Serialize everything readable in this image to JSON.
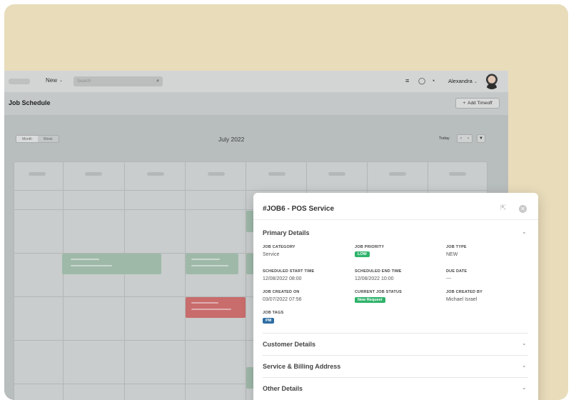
{
  "topbar": {
    "new_label": "New",
    "search_placeholder": "Search",
    "user_name": "Alexandra"
  },
  "page": {
    "title": "Job Schedule",
    "add_timeoff_label": "Add Timeoff"
  },
  "calendar": {
    "view_options": [
      "Month",
      "Week"
    ],
    "active_view": "Month",
    "month_title": "July 2022",
    "today_label": "Today"
  },
  "panel": {
    "title": "#JOB6 - POS Service",
    "sections": {
      "primary": "Primary Details",
      "customer": "Customer Details",
      "billing": "Service & Billing Address",
      "other": "Other Details"
    },
    "fields": {
      "job_category": {
        "label": "JOB CATEGORY",
        "value": "Service"
      },
      "job_priority": {
        "label": "JOB PRIORITY",
        "value": "LOW"
      },
      "job_type": {
        "label": "JOB TYPE",
        "value": "NEW"
      },
      "scheduled_start": {
        "label": "SCHEDULED START TIME",
        "value": "12/08/2022 08:00"
      },
      "scheduled_end": {
        "label": "SCHEDULED END TIME",
        "value": "12/08/2022 10:00"
      },
      "due_date": {
        "label": "DUE DATE",
        "value": "---"
      },
      "job_created_on": {
        "label": "JOB CREATED ON",
        "value": "03/07/2022 07:56"
      },
      "current_status": {
        "label": "CURRENT JOB STATUS",
        "value": "New Request"
      },
      "job_created_by": {
        "label": "JOB CREATED BY",
        "value": "Michael Israel"
      },
      "job_tags": {
        "label": "JOB TAGS",
        "value": "PM"
      }
    }
  },
  "colors": {
    "background_card": "#e8dcbb",
    "status_green": "#2fb36a",
    "tag_blue": "#2e6ea3",
    "event_green": "#9fb9a9",
    "event_red": "#c86c6c"
  }
}
